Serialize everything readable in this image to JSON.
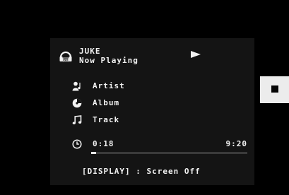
{
  "screen": {
    "source": {
      "name": "JUKE",
      "status": "Now Playing",
      "icon": "juke-headphones-icon",
      "playback_icon": "play-icon"
    },
    "info_rows": [
      {
        "icon": "artist-icon",
        "label": "Artist"
      },
      {
        "icon": "album-icon",
        "label": "Album"
      },
      {
        "icon": "music-note-icon",
        "label": "Track"
      }
    ],
    "time": {
      "icon": "clock-icon",
      "elapsed": "0:18",
      "total": "9:20",
      "progress": 0.032
    },
    "hint": "[DISPLAY] : Screen Off"
  },
  "side_control": {
    "icon": "stop-icon"
  },
  "colors": {
    "background": "#000000",
    "screen": "#141414",
    "text": "#f2f2f2",
    "side_panel": "#ececec"
  }
}
